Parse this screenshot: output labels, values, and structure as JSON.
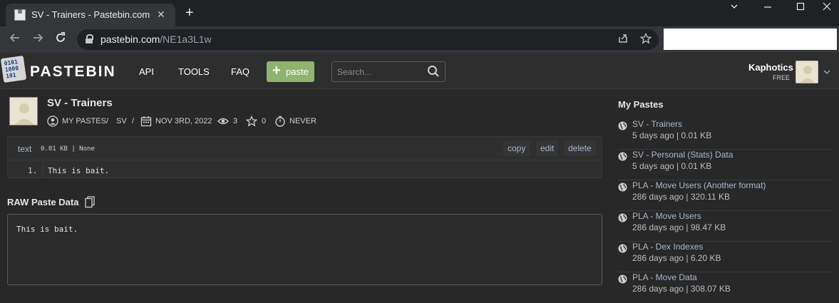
{
  "browser": {
    "tab_title": "SV - Trainers - Pastebin.com",
    "tab_close": "✕",
    "new_tab": "+",
    "url_host": "pastebin.com",
    "url_path": "/NE1a3L1w"
  },
  "header": {
    "logo_text": "PASTEBIN",
    "nav": [
      "API",
      "TOOLS",
      "FAQ"
    ],
    "paste_button": "paste",
    "search_placeholder": "Search...",
    "user_name": "Kaphotics",
    "user_plan": "FREE"
  },
  "post": {
    "title": "SV - Trainers",
    "author_link": "MY PASTES",
    "separator": "/",
    "folder": "SV",
    "date": "NOV 3RD, 2022",
    "views": "3",
    "stars": "0",
    "expiry": "NEVER"
  },
  "code": {
    "language": "text",
    "size_info": "0.01 KB | None",
    "actions": [
      "copy",
      "edit",
      "delete"
    ],
    "line_number": "1.",
    "line_text": "This is bait."
  },
  "raw": {
    "title": "RAW Paste Data",
    "text": "This is bait."
  },
  "sidebar": {
    "title": "My Pastes",
    "items": [
      {
        "name": "SV - Trainers",
        "info": "5 days ago | 0.01 KB"
      },
      {
        "name": "SV - Personal (Stats) Data",
        "info": "5 days ago | 0.01 KB"
      },
      {
        "name": "PLA - Move Users (Another format)",
        "info": "286 days ago | 320.11 KB"
      },
      {
        "name": "PLA - Move Users",
        "info": "286 days ago | 98.47 KB"
      },
      {
        "name": "PLA - Dex Indexes",
        "info": "286 days ago | 6.20 KB"
      },
      {
        "name": "PLA - Move Data",
        "info": "286 days ago | 308.07 KB"
      }
    ]
  }
}
